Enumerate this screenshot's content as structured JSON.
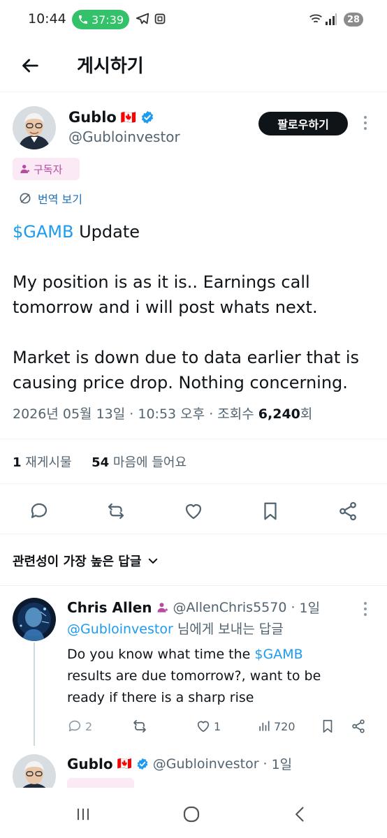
{
  "status_bar": {
    "time": "10:44",
    "call_timer": "37:39",
    "battery": "28"
  },
  "header": {
    "title": "게시하기"
  },
  "post": {
    "author": {
      "name": "Gublo",
      "flag": "🇨🇦",
      "handle": "@Gubloinvestor"
    },
    "follow_label": "팔로우하기",
    "subscriber_badge": "구독자",
    "translate_label": "번역 보기",
    "body": {
      "cashtag": "$GAMB",
      "line1_rest": " Update",
      "line2": "My position is as it is.. Earnings call",
      "line3": "tomorrow and i will post whats next.",
      "line4": "Market is down due to data earlier that is",
      "line5": "causing price drop. Nothing concerning."
    },
    "meta": {
      "date": "2026년 05월 13일",
      "time": "10:53 오후",
      "views_label": "조회수",
      "views": "6,240",
      "views_suffix": "회"
    },
    "stats": {
      "reposts": "1",
      "reposts_label": "재게시물",
      "likes": "54",
      "likes_label": "마음에 들어요"
    }
  },
  "replies_sort": {
    "label": "관련성이 가장 높은 답글"
  },
  "reply": {
    "name": "Chris Allen",
    "handle": "@AllenChris5570",
    "time": "1일",
    "replying_mention": "@Gubloinvestor",
    "replying_suffix": " 님에게 보내는 답글",
    "text_line1_pre": "Do you know what time the ",
    "text_line1_cashtag": "$GAMB",
    "text_line2": "results are due tomorrow?, want to be",
    "text_line3": "ready if there is a  sharp rise",
    "reply_count": "2",
    "like_count": "1",
    "view_count": "720"
  },
  "second_reply": {
    "name": "Gublo",
    "flag": "🇨🇦",
    "handle": "@Gubloinvestor",
    "time": "1일"
  },
  "colors": {
    "link": "#1d9bf0",
    "badge_bg": "#fbe9f5",
    "badge_fg": "#b64ca0",
    "verified": "#1d9bf0",
    "call_pill": "#33c26a"
  }
}
